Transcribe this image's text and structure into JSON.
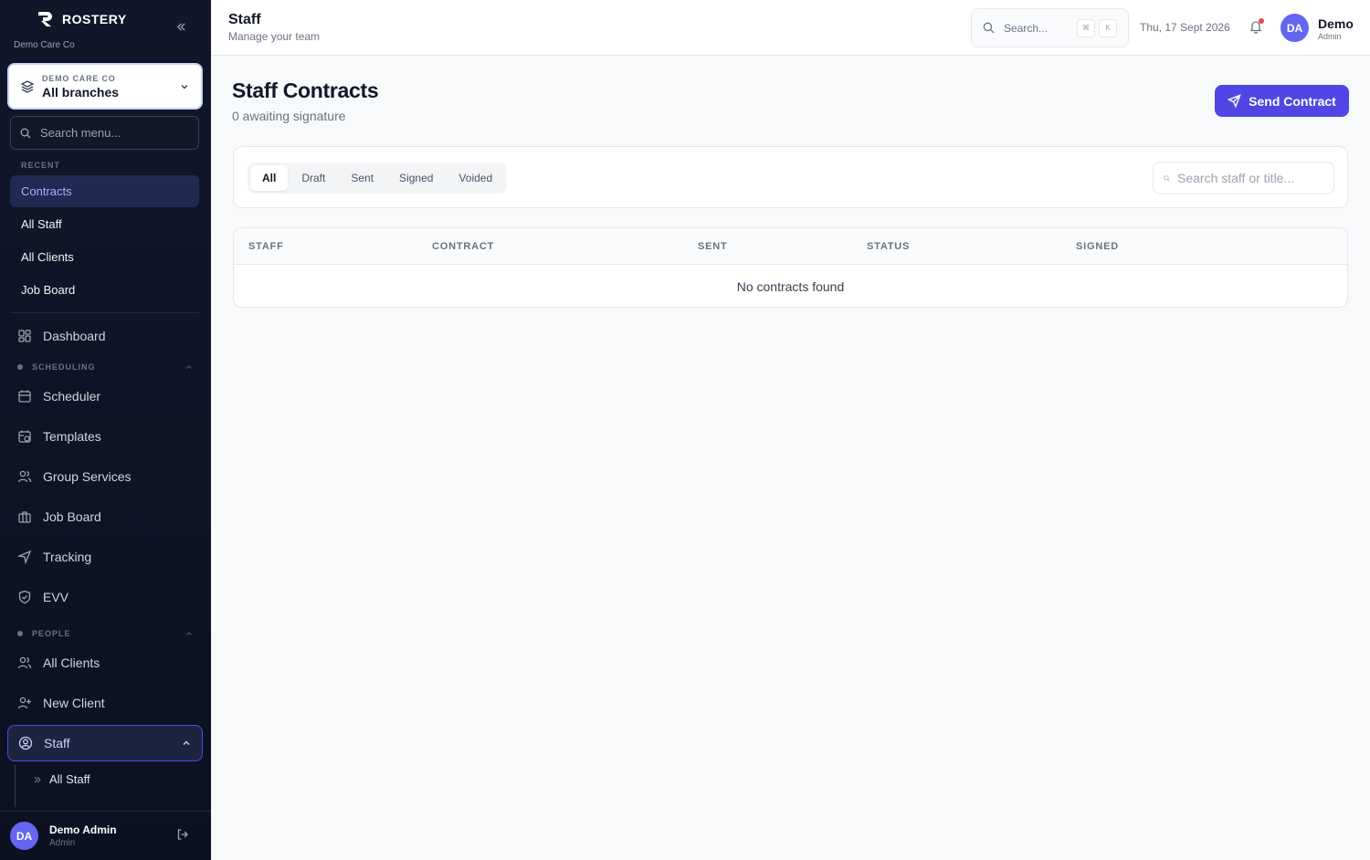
{
  "sidebar": {
    "brand": "ROSTERY",
    "org_sub": "Demo Care Co",
    "branch": {
      "org": "DEMO CARE CO",
      "name": "All branches"
    },
    "search_placeholder": "Search menu...",
    "recent_label": "RECENT",
    "recent": [
      "Contracts",
      "All Staff",
      "All Clients",
      "Job Board"
    ],
    "nav_top": {
      "dashboard": "Dashboard"
    },
    "scheduling_label": "SCHEDULING",
    "scheduling": [
      "Scheduler",
      "Templates",
      "Group Services",
      "Job Board",
      "Tracking",
      "EVV"
    ],
    "people_label": "PEOPLE",
    "people": [
      "All Clients",
      "New Client",
      "Staff"
    ],
    "staff_sub": [
      "All Staff"
    ],
    "user": {
      "initials": "DA",
      "name": "Demo Admin",
      "role": "Admin"
    }
  },
  "topbar": {
    "title": "Staff",
    "subtitle": "Manage your team",
    "search_placeholder": "Search...",
    "shortcut_keys": [
      "⌘",
      "K"
    ],
    "date": "Thu, 17 Sept 2026",
    "user": {
      "initials": "DA",
      "name": "Demo",
      "role": "Admin"
    }
  },
  "main": {
    "title": "Staff Contracts",
    "subtitle": "0 awaiting signature",
    "send_button": "Send Contract",
    "tabs": [
      "All",
      "Draft",
      "Sent",
      "Signed",
      "Voided"
    ],
    "active_tab": "All",
    "search_placeholder": "Search staff or title...",
    "table": {
      "columns": [
        "STAFF",
        "CONTRACT",
        "SENT",
        "STATUS",
        "SIGNED"
      ],
      "empty_message": "No contracts found"
    }
  },
  "colors": {
    "accent": "#4f46e5",
    "sidebar_bg": "#0f172a",
    "notification_dot": "#ef4444"
  }
}
